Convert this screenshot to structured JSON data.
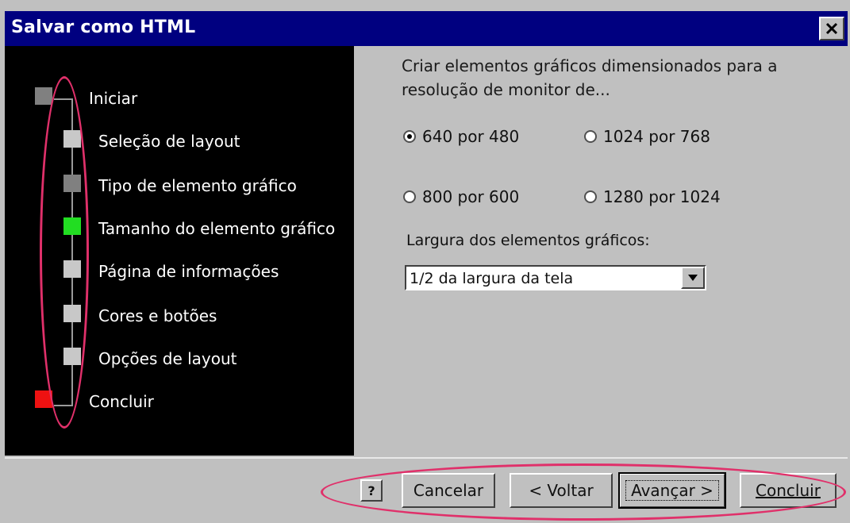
{
  "window": {
    "title": "Salvar como HTML"
  },
  "steps": [
    {
      "label": "Iniciar",
      "color": "#808080"
    },
    {
      "label": "Seleção de layout",
      "color": "#c8c8c8"
    },
    {
      "label": "Tipo de elemento gráfico",
      "color": "#808080"
    },
    {
      "label": "Tamanho do elemento gráfico",
      "color": "#22dd22"
    },
    {
      "label": "Página de informações",
      "color": "#c8c8c8"
    },
    {
      "label": "Cores e botões",
      "color": "#c8c8c8"
    },
    {
      "label": "Opções de layout",
      "color": "#c8c8c8"
    },
    {
      "label": "Concluir",
      "color": "#ee1111"
    }
  ],
  "main": {
    "intro": "Criar elementos gráficos dimensionados para a resolução de monitor de...",
    "resolutions": [
      {
        "label": "640 por 480",
        "selected": true
      },
      {
        "label": "1024 por 768",
        "selected": false
      },
      {
        "label": "800 por 600",
        "selected": false
      },
      {
        "label": "1280 por 1024",
        "selected": false
      }
    ],
    "width_label": "Largura dos elementos gráficos:",
    "width_value": "1/2 da largura da tela"
  },
  "buttons": {
    "help": "?",
    "cancel": "Cancelar",
    "back": "< Voltar",
    "next": "Avançar >",
    "finish": "Concluir"
  },
  "annotation_color": "#e0306a"
}
